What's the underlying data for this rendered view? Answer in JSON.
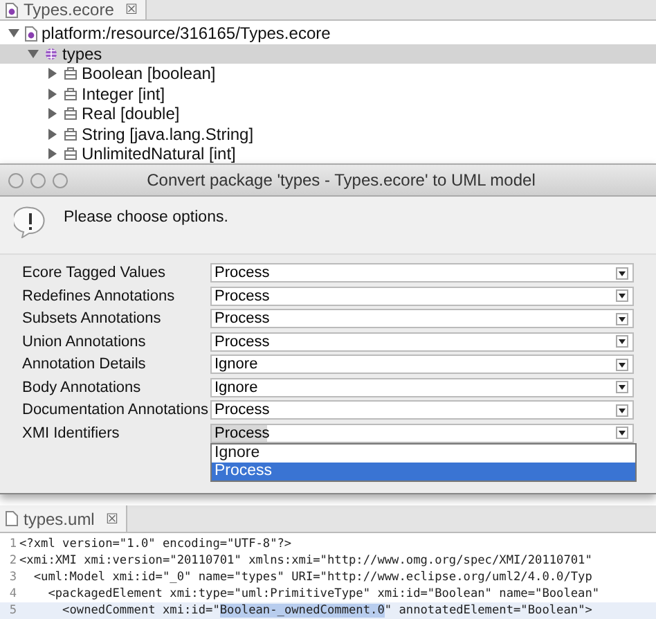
{
  "top_editor": {
    "tab": {
      "title": "Types.ecore",
      "close": "☒"
    },
    "tree": [
      {
        "label": "platform:/resource/316165/Types.ecore",
        "expanded": true,
        "selected": false,
        "kind": "resource",
        "children": [
          {
            "label": "types",
            "expanded": true,
            "selected": true,
            "kind": "package",
            "children": [
              {
                "label": "Boolean [boolean]",
                "expanded": false,
                "selected": false,
                "kind": "datatype"
              },
              {
                "label": "Integer [int]",
                "expanded": false,
                "selected": false,
                "kind": "datatype"
              },
              {
                "label": "Real [double]",
                "expanded": false,
                "selected": false,
                "kind": "datatype"
              },
              {
                "label": "String [java.lang.String]",
                "expanded": false,
                "selected": false,
                "kind": "datatype"
              },
              {
                "label": "UnlimitedNatural [int]",
                "expanded": false,
                "selected": false,
                "kind": "datatype"
              }
            ]
          }
        ]
      }
    ]
  },
  "dialog": {
    "title": "Convert package 'types - Types.ecore' to UML model",
    "message": "Please choose options.",
    "options": [
      {
        "label": "Ecore Tagged Values",
        "value": "Process",
        "open": false
      },
      {
        "label": "Redefines Annotations",
        "value": "Process",
        "open": false
      },
      {
        "label": "Subsets Annotations",
        "value": "Process",
        "open": false
      },
      {
        "label": "Union Annotations",
        "value": "Process",
        "open": false
      },
      {
        "label": "Annotation Details",
        "value": "Ignore",
        "open": false
      },
      {
        "label": "Body Annotations",
        "value": "Ignore",
        "open": false
      },
      {
        "label": "Documentation Annotations",
        "value": "Process",
        "open": false
      },
      {
        "label": "XMI Identifiers",
        "value": "Process",
        "open": true,
        "choices": [
          {
            "label": "Ignore",
            "selected": false
          },
          {
            "label": "Process",
            "selected": true
          }
        ]
      }
    ]
  },
  "bottom_editor": {
    "tab": {
      "title": "types.uml",
      "close": "☒"
    },
    "lines": [
      {
        "number": "1",
        "highlighted": false,
        "segments": [
          {
            "text": "<?xml version=\"1.0\" encoding=\"UTF-8\"?>",
            "selected": false
          }
        ]
      },
      {
        "number": "2",
        "highlighted": false,
        "segments": [
          {
            "text": "<xmi:XMI xmi:version=\"20110701\" xmlns:xmi=\"http://www.omg.org/spec/XMI/20110701\"",
            "selected": false
          }
        ]
      },
      {
        "number": "3",
        "highlighted": false,
        "segments": [
          {
            "text": "  <uml:Model xmi:id=\"_0\" name=\"types\" URI=\"http://www.eclipse.org/uml2/4.0.0/Typ",
            "selected": false
          }
        ]
      },
      {
        "number": "4",
        "highlighted": false,
        "segments": [
          {
            "text": "    <packagedElement xmi:type=\"uml:PrimitiveType\" xmi:id=\"Boolean\" name=\"Boolean\"",
            "selected": false
          }
        ]
      },
      {
        "number": "5",
        "highlighted": true,
        "segments": [
          {
            "text": "      <ownedComment xmi:id=\"",
            "selected": false
          },
          {
            "text": "Boolean-_ownedComment.0",
            "selected": true
          },
          {
            "text": "\" annotatedElement=\"Boolean\">",
            "selected": false
          }
        ]
      }
    ]
  }
}
